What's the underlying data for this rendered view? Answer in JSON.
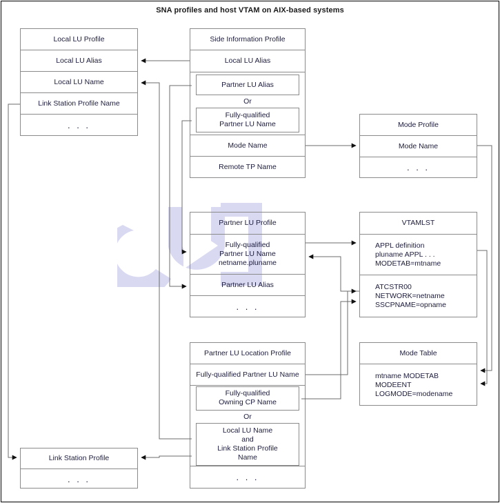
{
  "title": "SNA profiles and host VTAM on AIX-based systems",
  "colors": {
    "box_border": "#8a8a8a",
    "frame_border": "#000000",
    "text": "#1c1c3c",
    "wire": "#6b6b6b",
    "watermark": "#d9d9f2",
    "background": "#ffffff"
  },
  "ellipsis": ". . .",
  "or_label": "Or",
  "boxes": {
    "local_lu_profile": {
      "name": "Local LU Profile",
      "rows": [
        "Local LU Profile",
        "Local LU Alias",
        "Local LU Name",
        "Link Station Profile Name",
        ". . ."
      ]
    },
    "side_information_profile": {
      "name": "Side Information Profile",
      "header": "Side Information Profile",
      "row_local_lu_alias": "Local LU Alias",
      "alt_a": "Partner LU Alias",
      "alt_b": "Fully-qualified\nPartner LU Name",
      "row_mode_name": "Mode Name",
      "row_remote_tp_name": "Remote TP Name"
    },
    "mode_profile": {
      "name": "Mode Profile",
      "rows": [
        "Mode Profile",
        "Mode Name",
        ". . ."
      ]
    },
    "partner_lu_profile": {
      "name": "Partner LU Profile",
      "rows": [
        "Partner LU Profile",
        "Fully-qualified\nPartner LU Name\nnetname.pluname",
        "Partner LU Alias",
        ". . ."
      ]
    },
    "vtamlst": {
      "name": "VTAMLST",
      "header": "VTAMLST",
      "appl_definition": "APPL definition\n   pluname APPL . . .\n      MODETAB=mtname",
      "atcstr00": "ATCSTR00\n   NETWORK=netname\n   SSCPNAME=opname"
    },
    "partner_lu_location_profile": {
      "name": "Partner LU Location Profile",
      "header": "Partner LU Location Profile",
      "row_fq_partner_lu_name": "Fully-qualified Partner LU Name",
      "alt_a": "Fully-qualified\nOwning CP Name",
      "alt_b": "Local LU Name\nand\nLink Station Profile\nName",
      "row_dots": ". . ."
    },
    "mode_table": {
      "name": "Mode Table",
      "header": "Mode Table",
      "body": "mtname MODETAB\n  MODEENT\n      LOGMODE=modename"
    },
    "link_station_profile": {
      "name": "Link Station Profile",
      "rows": [
        "Link Station Profile",
        ". . ."
      ]
    }
  }
}
